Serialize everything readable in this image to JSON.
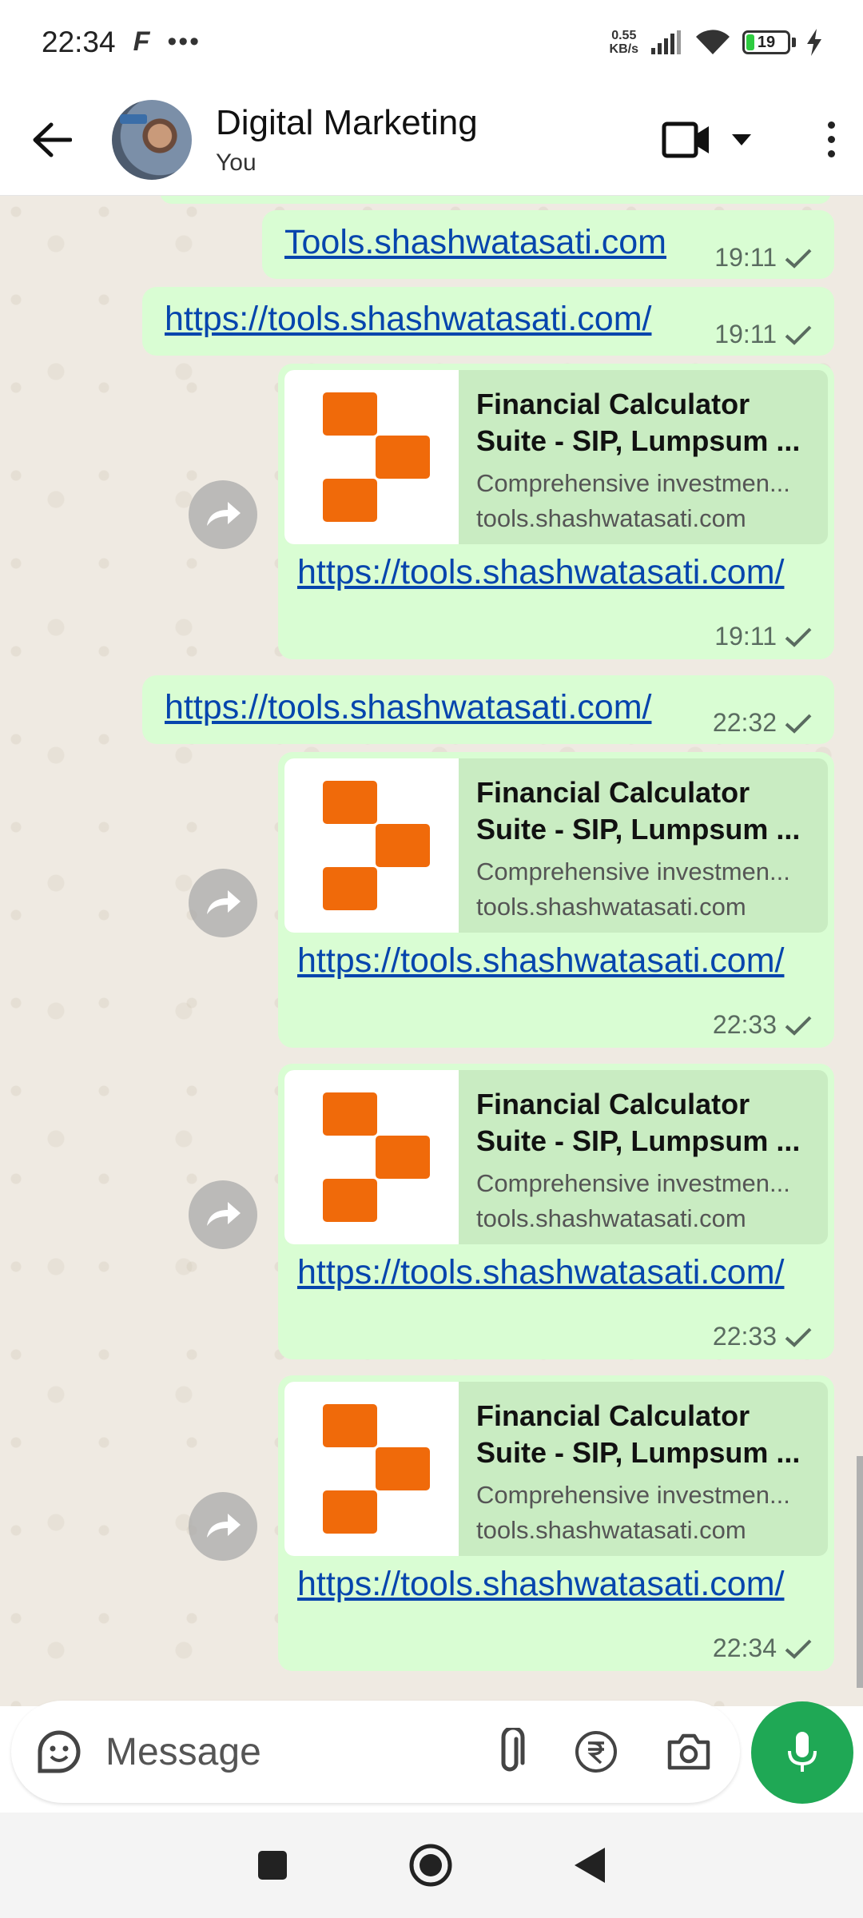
{
  "status_bar": {
    "time": "22:34",
    "net_speed_value": "0.55",
    "net_speed_unit": "KB/s",
    "battery": "19",
    "battery_level_percent": 19
  },
  "header": {
    "title": "Digital Marketing",
    "subtitle": "You"
  },
  "messages": [
    {
      "link": "Tools.shashwatasati.com",
      "time": "19:11"
    },
    {
      "link": "https://tools.shashwatasati.com/",
      "time": "19:11"
    },
    {
      "preview_title": "Financial Calculator Suite - SIP, Lumpsum ...",
      "preview_desc": "Comprehensive investmen...",
      "preview_domain": "tools.shashwatasati.com",
      "link": "https://tools.shashwatasati.com/",
      "time": "19:11"
    },
    {
      "link": "https://tools.shashwatasati.com/",
      "time": "22:32"
    },
    {
      "preview_title": "Financial Calculator Suite - SIP, Lumpsum ...",
      "preview_desc": "Comprehensive investmen...",
      "preview_domain": "tools.shashwatasati.com",
      "link": "https://tools.shashwatasati.com/",
      "time": "22:33"
    },
    {
      "preview_title": "Financial Calculator Suite - SIP, Lumpsum ...",
      "preview_desc": "Comprehensive investmen...",
      "preview_domain": "tools.shashwatasati.com",
      "link": "https://tools.shashwatasati.com/",
      "time": "22:33"
    },
    {
      "preview_title": "Financial Calculator Suite - SIP, Lumpsum ...",
      "preview_desc": "Comprehensive investmen...",
      "preview_domain": "tools.shashwatasati.com",
      "link": "https://tools.shashwatasati.com/",
      "time": "22:34"
    }
  ],
  "input": {
    "placeholder": "Message"
  },
  "icons": {
    "back": "arrow-left-icon",
    "video": "video-camera-icon",
    "more": "more-vert-icon",
    "sticker": "sticker-icon",
    "attach": "paperclip-icon",
    "payment": "rupee-icon",
    "camera": "camera-icon",
    "mic": "microphone-icon",
    "forward": "forward-icon",
    "read": "check-icon"
  },
  "colors": {
    "bubble_out": "#d9fdd3",
    "link": "#0645ad",
    "accent_green": "#1fa855",
    "logo_orange": "#f06a0a",
    "chat_bg": "#efeae2"
  }
}
